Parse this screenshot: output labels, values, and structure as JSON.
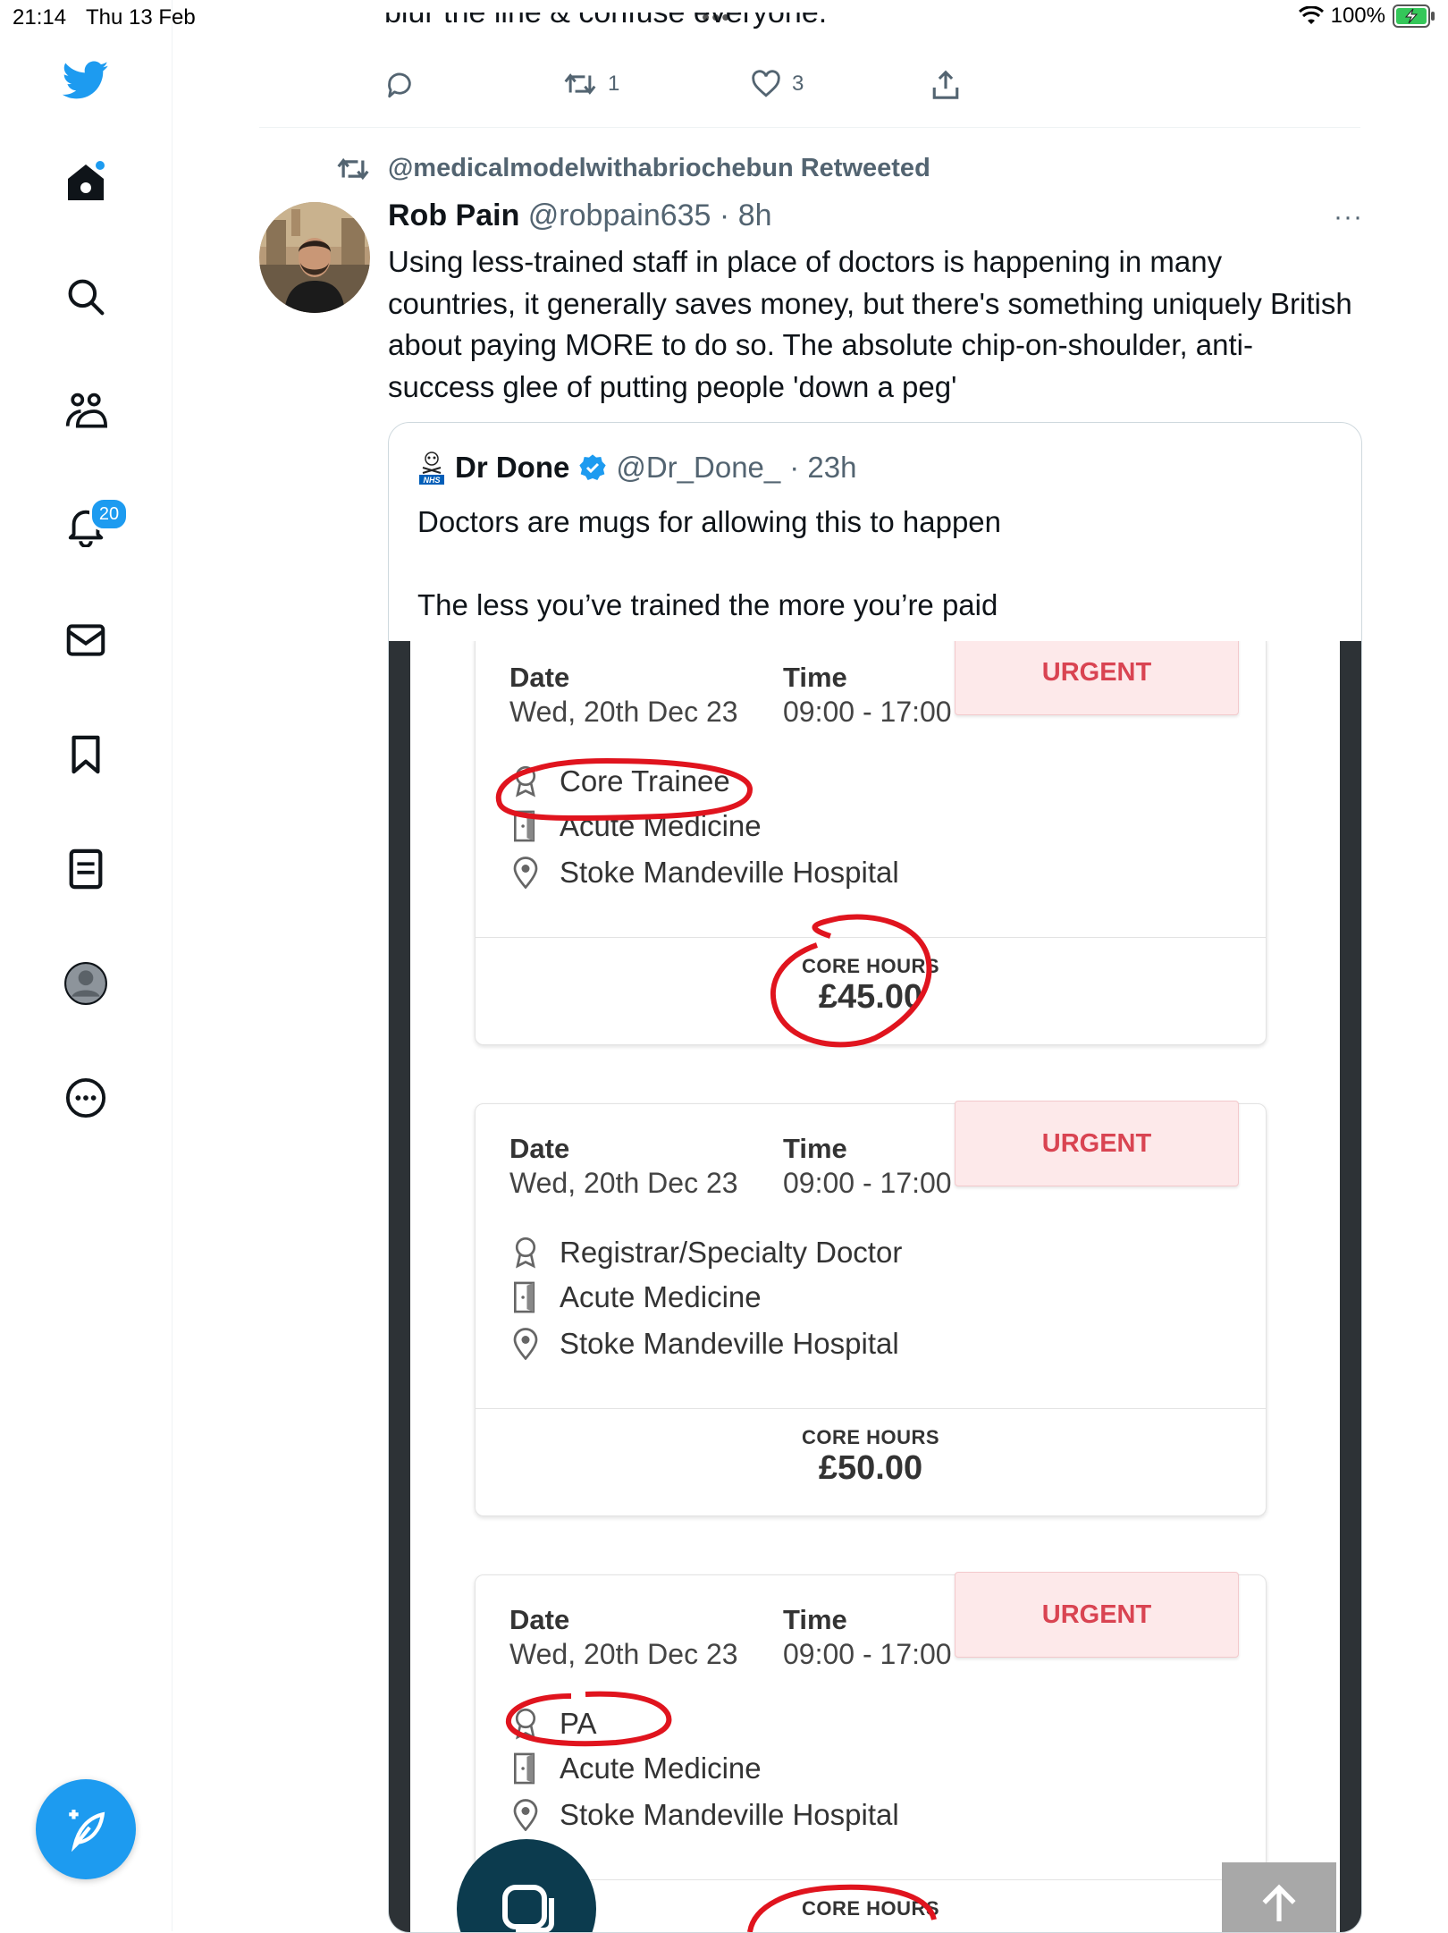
{
  "status_bar": {
    "time": "21:14",
    "date": "Thu 13 Feb",
    "battery": "100%"
  },
  "sidebar": {
    "items": [
      {
        "icon": "twitter-logo-icon"
      },
      {
        "icon": "home-icon"
      },
      {
        "icon": "search-icon"
      },
      {
        "icon": "communities-icon"
      },
      {
        "icon": "notifications-icon",
        "badge": "20"
      },
      {
        "icon": "messages-icon"
      },
      {
        "icon": "bookmarks-icon"
      },
      {
        "icon": "lists-icon"
      },
      {
        "icon": "profile-icon"
      },
      {
        "icon": "more-icon"
      }
    ],
    "compose_icon": "compose-icon"
  },
  "previous_tweet": {
    "cutoff_text": "blur the line & confuse everyone.",
    "retweet_count": "1",
    "like_count": "3"
  },
  "tweet": {
    "retweet_header": "@medicalmodelwithabriochebun Retweeted",
    "author_name": "Rob Pain",
    "author_handle": "@robpain635",
    "time": "· 8h",
    "more": "···",
    "text": "Using less-trained staff in place of doctors is happening in many countries, it generally saves money, but there's something uniquely British about paying MORE to do so.  The absolute chip-on-shoulder, anti-success glee of putting people 'down a peg'"
  },
  "quoted_tweet": {
    "author_name": "Dr Done",
    "author_handle": "@Dr_Done_",
    "time": "· 23h",
    "text": "Doctors are mugs for allowing this to happen\n\nThe less you’ve trained the more you’re paid"
  },
  "shift_cards": [
    {
      "urgent": "URGENT",
      "date_label": "Date",
      "date_value": "Wed, 20th Dec 23",
      "time_label": "Time",
      "time_value": "09:00 - 17:00",
      "grade": "Core Trainee",
      "specialty": "Acute Medicine",
      "location": "Stoke Mandeville Hospital",
      "core_hours_label": "CORE HOURS",
      "rate": "£45.00"
    },
    {
      "urgent": "URGENT",
      "date_label": "Date",
      "date_value": "Wed, 20th Dec 23",
      "time_label": "Time",
      "time_value": "09:00 - 17:00",
      "grade": "Registrar/Specialty Doctor",
      "specialty": "Acute Medicine",
      "location": "Stoke Mandeville Hospital",
      "core_hours_label": "CORE HOURS",
      "rate": "£50.00"
    },
    {
      "urgent": "URGENT",
      "date_label": "Date",
      "date_value": "Wed, 20th Dec 23",
      "time_label": "Time",
      "time_value": "09:00 - 17:00",
      "grade": "PA",
      "specialty": "Acute Medicine",
      "location": "Stoke Mandeville Hospital",
      "core_hours_label": "CORE HOURS",
      "rate": ""
    }
  ],
  "colors": {
    "twitter_blue": "#1d9bf0",
    "urgent_red": "#d94452",
    "annotation_red": "#e0141e"
  }
}
